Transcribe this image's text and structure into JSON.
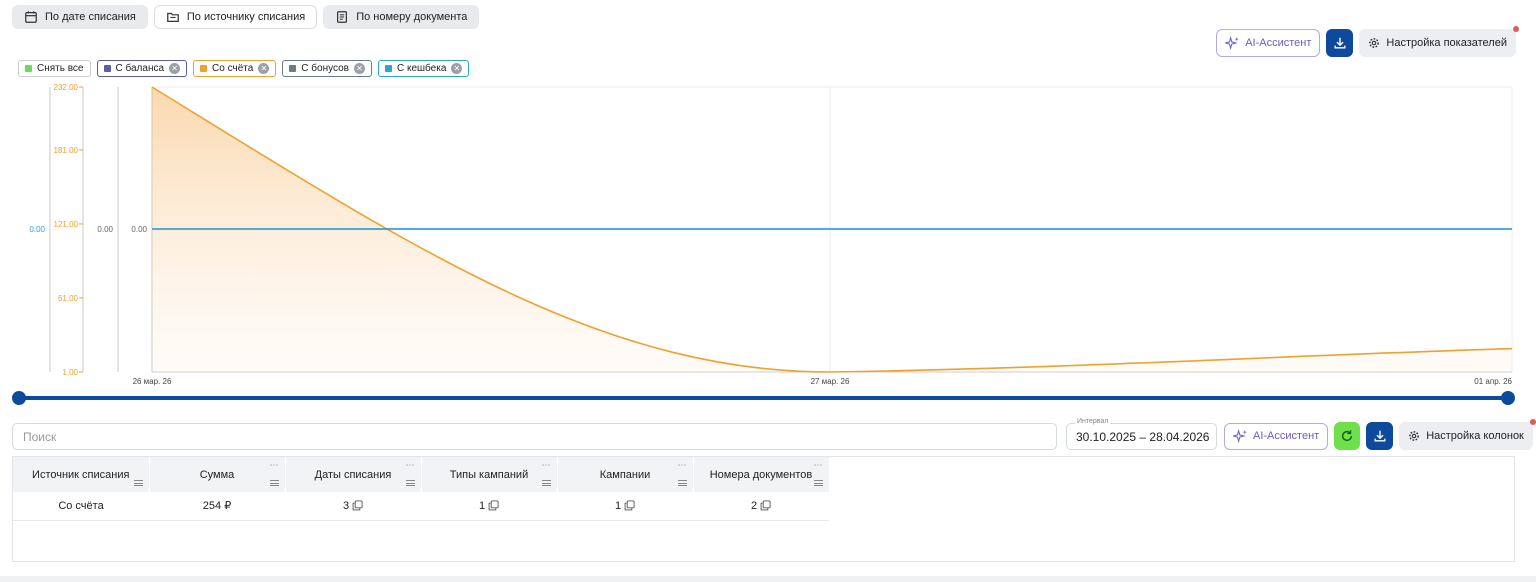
{
  "tabs": [
    {
      "label": "По дате списания",
      "active": false,
      "icon": "calendar-icon"
    },
    {
      "label": "По источнику списания",
      "active": true,
      "icon": "folder-icon"
    },
    {
      "label": "По номеру документа",
      "active": false,
      "icon": "document-icon"
    }
  ],
  "toolbar": {
    "ai_label": "AI-Ассистент",
    "settings_label": "Настройка показателей"
  },
  "legend": [
    {
      "label": "Снять все",
      "color": "#66dd55",
      "closable": false
    },
    {
      "label": "С баланса",
      "color": "#5b5ea6",
      "closable": true
    },
    {
      "label": "Со счёта",
      "color": "#f0a030",
      "closable": true
    },
    {
      "label": "С бонусов",
      "color": "#6b7b8c",
      "closable": true
    },
    {
      "label": "С кешбека",
      "color": "#2ba3d6",
      "closable": true
    }
  ],
  "chart_data": {
    "type": "area",
    "x": [
      "26 мар. 26",
      "27 мар. 26",
      "01 апр. 26"
    ],
    "series": [
      {
        "name": "Со счёта",
        "color": "#f0a030",
        "values": [
          232,
          1,
          20
        ]
      },
      {
        "name": "С кешбека",
        "color": "#1f8fd0",
        "values": [
          0,
          0,
          0
        ]
      }
    ],
    "axes": [
      {
        "ticks": [
          "0.00"
        ],
        "color": "#2ba3d6"
      },
      {
        "ticks": [
          "232.00",
          "181.00",
          "121.00",
          "61.00",
          "1.00"
        ],
        "color": "#f0a030"
      },
      {
        "ticks": [
          "0.00"
        ],
        "color": "#666666"
      },
      {
        "ticks": [
          "0.00"
        ],
        "color": "#666666"
      }
    ],
    "ylim": [
      1,
      232
    ]
  },
  "table_toolbar": {
    "search_placeholder": "Поиск",
    "interval_label": "Интервал",
    "interval_value": "30.10.2025 – 28.04.2026",
    "ai_label": "AI-Ассистент",
    "columns_settings_label": "Настройка колонок"
  },
  "table": {
    "columns": [
      "Источник списания",
      "Сумма",
      "Даты списания",
      "Типы кампаний",
      "Кампании",
      "Номера документов"
    ],
    "rows": [
      {
        "source": "Со счёта",
        "sum": "254 ₽",
        "dates": "3",
        "types": "1",
        "campaigns": "1",
        "docs": "2"
      }
    ]
  }
}
